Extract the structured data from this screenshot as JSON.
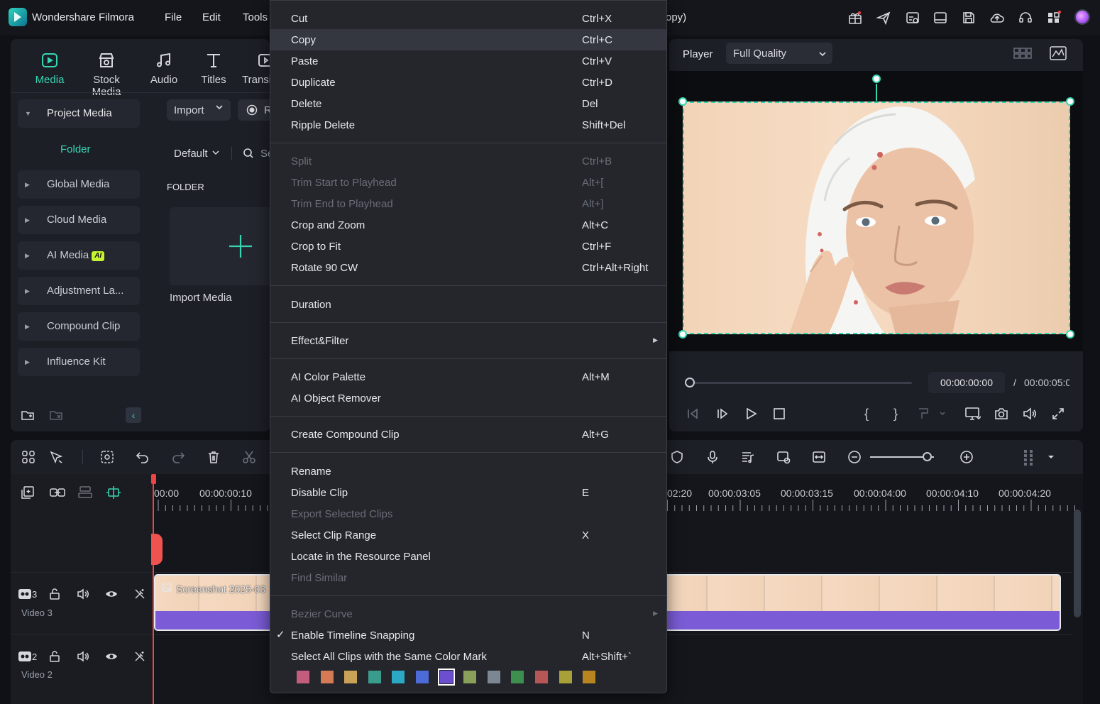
{
  "titlebar": {
    "app_title": "Wondershare Filmora",
    "menus": [
      "File",
      "Edit",
      "Tools"
    ],
    "project_fragment": "opy)",
    "icons": [
      "gift-icon",
      "send-icon",
      "activity-icon",
      "layout-icon",
      "save-icon",
      "cloud-icon",
      "headset-icon",
      "apps-icon",
      "avatar"
    ]
  },
  "left_panel": {
    "tabs": [
      {
        "label": "Media",
        "icon": "media-icon",
        "active": true
      },
      {
        "label": "Stock Media",
        "icon": "stock-media-icon"
      },
      {
        "label": "Audio",
        "icon": "audio-icon"
      },
      {
        "label": "Titles",
        "icon": "titles-icon"
      },
      {
        "label": "Transi",
        "icon": "transitions-icon"
      }
    ],
    "sidebar": {
      "project_media": "Project Media",
      "folder": "Folder",
      "items": [
        "Global Media",
        "Cloud Media",
        "AI Media",
        "Adjustment La...",
        "Compound Clip",
        "Influence Kit"
      ],
      "ai_badge": "AI"
    },
    "import_label": "Import",
    "record_fragment": "R",
    "sort_label": "Default",
    "search_fragment": "Se",
    "folder_heading": "FOLDER",
    "import_media_label": "Import Media"
  },
  "player": {
    "label": "Player",
    "quality": "Full Quality",
    "current_time": "00:00:00:00",
    "separator": "/",
    "duration": "00:00:05:0",
    "progress": 0
  },
  "timeline": {
    "ruler_left": [
      "00:00",
      "00:00:00:10"
    ],
    "ruler_right": [
      "02:20",
      "00:00:03:05",
      "00:00:03:15",
      "00:00:04:00",
      "00:00:04:10",
      "00:00:04:20"
    ],
    "tracks": [
      {
        "name": "Video 3",
        "number": "3"
      },
      {
        "name": "Video 2",
        "number": "2"
      }
    ],
    "clip_name": "Screenshot 2025-03",
    "zoom_level": 0.9
  },
  "context_menu": {
    "items": [
      {
        "label": "Cut",
        "shortcut": "Ctrl+X"
      },
      {
        "label": "Copy",
        "shortcut": "Ctrl+C"
      },
      {
        "label": "Paste",
        "shortcut": "Ctrl+V"
      },
      {
        "label": "Duplicate",
        "shortcut": "Ctrl+D"
      },
      {
        "label": "Delete",
        "shortcut": "Del"
      },
      {
        "label": "Ripple Delete",
        "shortcut": "Shift+Del"
      },
      {
        "label": "Split",
        "shortcut": "Ctrl+B"
      },
      {
        "label": "Trim Start to Playhead",
        "shortcut": "Alt+["
      },
      {
        "label": "Trim End to Playhead",
        "shortcut": "Alt+]"
      },
      {
        "label": "Crop and Zoom",
        "shortcut": "Alt+C"
      },
      {
        "label": "Crop to Fit",
        "shortcut": "Ctrl+F"
      },
      {
        "label": "Rotate 90 CW",
        "shortcut": "Ctrl+Alt+Right"
      },
      {
        "label": "Duration",
        "shortcut": ""
      },
      {
        "label": "Effect&Filter",
        "shortcut": ""
      },
      {
        "label": "AI Color Palette",
        "shortcut": "Alt+M"
      },
      {
        "label": "AI Object Remover",
        "shortcut": ""
      },
      {
        "label": "Create Compound Clip",
        "shortcut": "Alt+G"
      },
      {
        "label": "Rename",
        "shortcut": ""
      },
      {
        "label": "Disable Clip",
        "shortcut": "E"
      },
      {
        "label": "Export Selected Clips",
        "shortcut": ""
      },
      {
        "label": "Select Clip Range",
        "shortcut": "X"
      },
      {
        "label": "Locate in the Resource Panel",
        "shortcut": ""
      },
      {
        "label": "Find Similar",
        "shortcut": ""
      },
      {
        "label": "Bezier Curve",
        "shortcut": ""
      },
      {
        "label": "Enable Timeline Snapping",
        "shortcut": "N"
      },
      {
        "label": "Select All Clips with the Same Color Mark",
        "shortcut": "Alt+Shift+`"
      }
    ],
    "color_marks": [
      "#c45c7e",
      "#d47a55",
      "#c9a257",
      "#3a9c8c",
      "#2aa8c4",
      "#4c6bd6",
      "#6b4fcf",
      "#8aa05a",
      "#7c8794",
      "#3d8f4f",
      "#b75656",
      "#a8a13a",
      "#b8841f"
    ],
    "selected_color_index": 6
  },
  "colors": {
    "accent": "#37d6b3",
    "clip_bar": "#7b5cd6",
    "playhead": "#ef4444"
  }
}
